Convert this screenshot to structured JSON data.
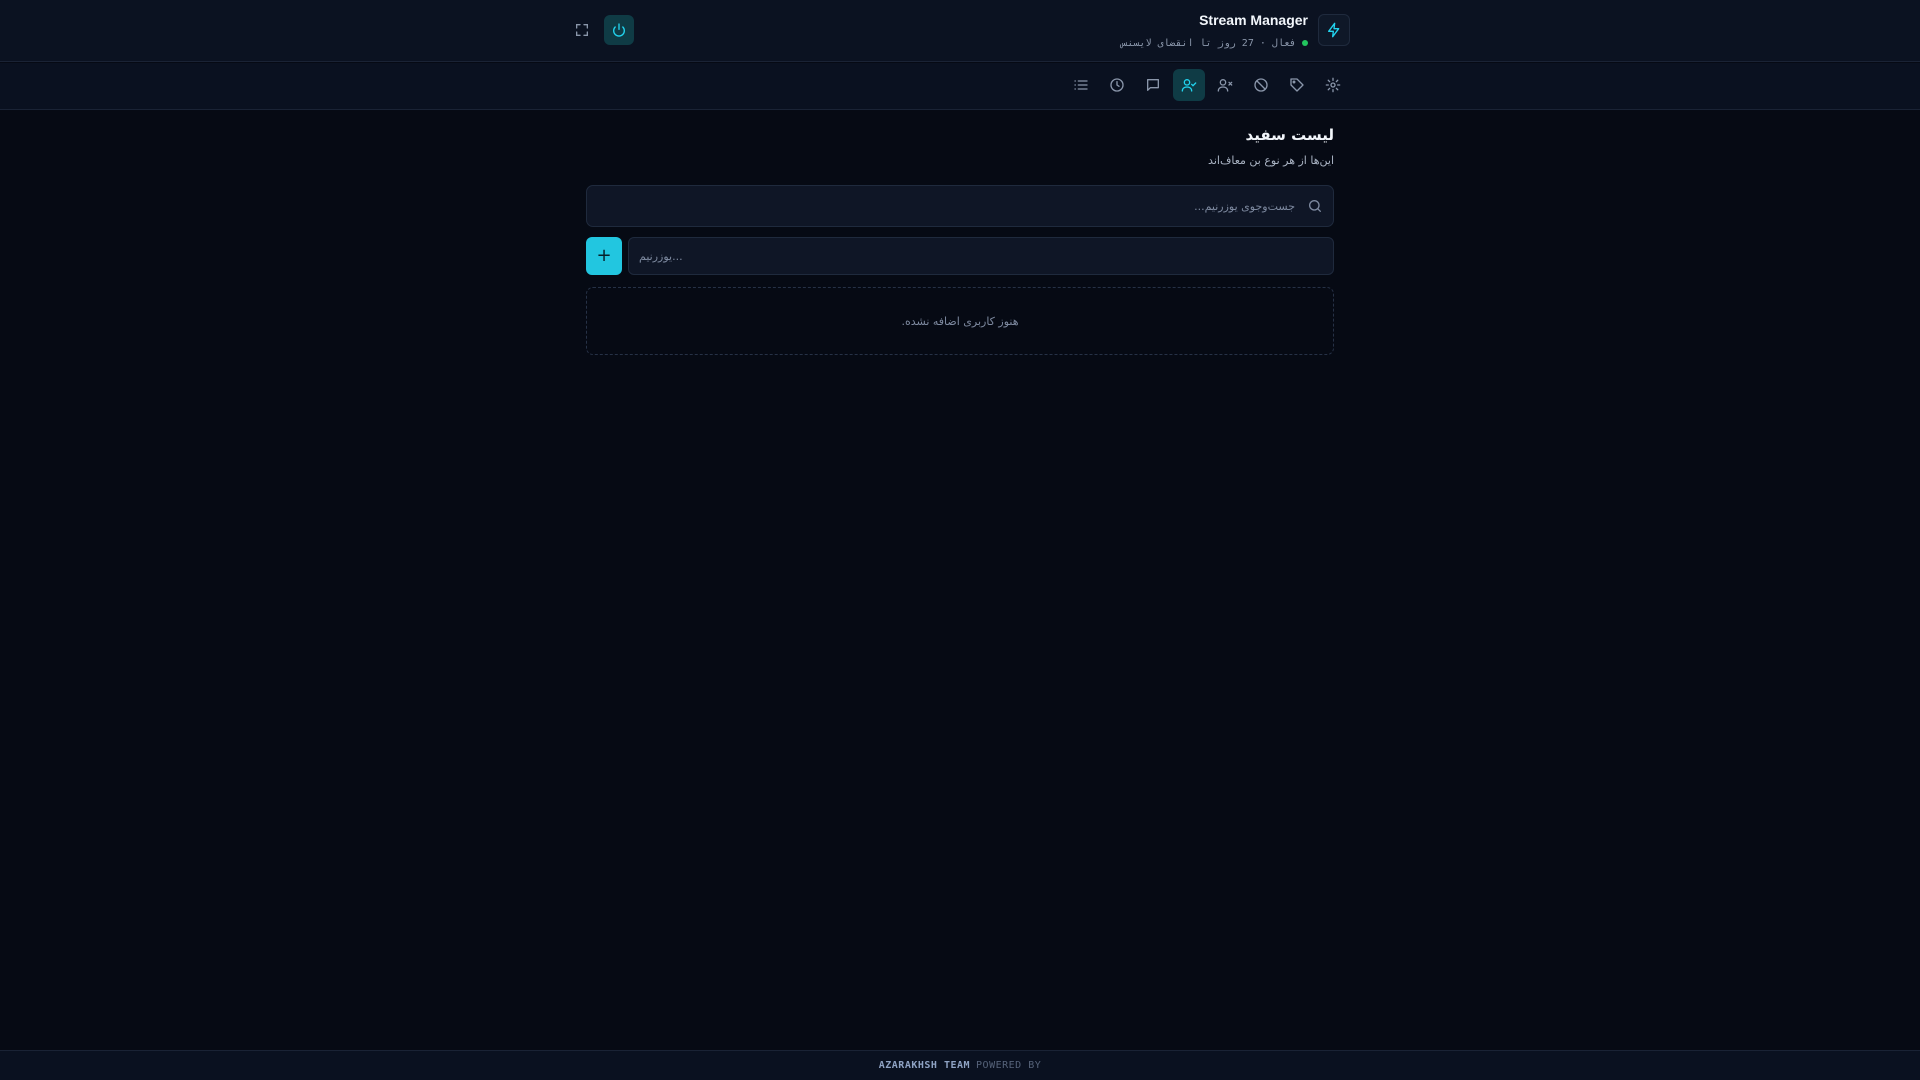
{
  "header": {
    "app_title": "Stream Manager",
    "status_text": "فعال · 27 روز تا انقضای لایسنس",
    "brand_icon": "lightning-icon",
    "accent": "#22d3ee",
    "status_color": "#22c55e"
  },
  "toolbar": {
    "tools": [
      {
        "icon": "settings-icon"
      },
      {
        "icon": "tag-icon"
      },
      {
        "icon": "ban-icon"
      },
      {
        "icon": "user-x-icon"
      },
      {
        "icon": "user-check-icon",
        "active": true
      },
      {
        "icon": "message-icon"
      },
      {
        "icon": "clock-icon"
      },
      {
        "icon": "list-icon"
      }
    ]
  },
  "section": {
    "title": "لیست سفید",
    "subtitle": "این‌ها از هر نوع بن معاف‌اند"
  },
  "search": {
    "placeholder": "جست‌وجوی یوزرنیم...",
    "value": ""
  },
  "add_user": {
    "placeholder": "یوزرنیم...",
    "button_label": "+"
  },
  "empty_state": {
    "text": "هنوز کاربری اضافه نشده."
  },
  "footer": {
    "team": "AZARAKHSH TEAM",
    "powered_by": "POWERED BY"
  }
}
